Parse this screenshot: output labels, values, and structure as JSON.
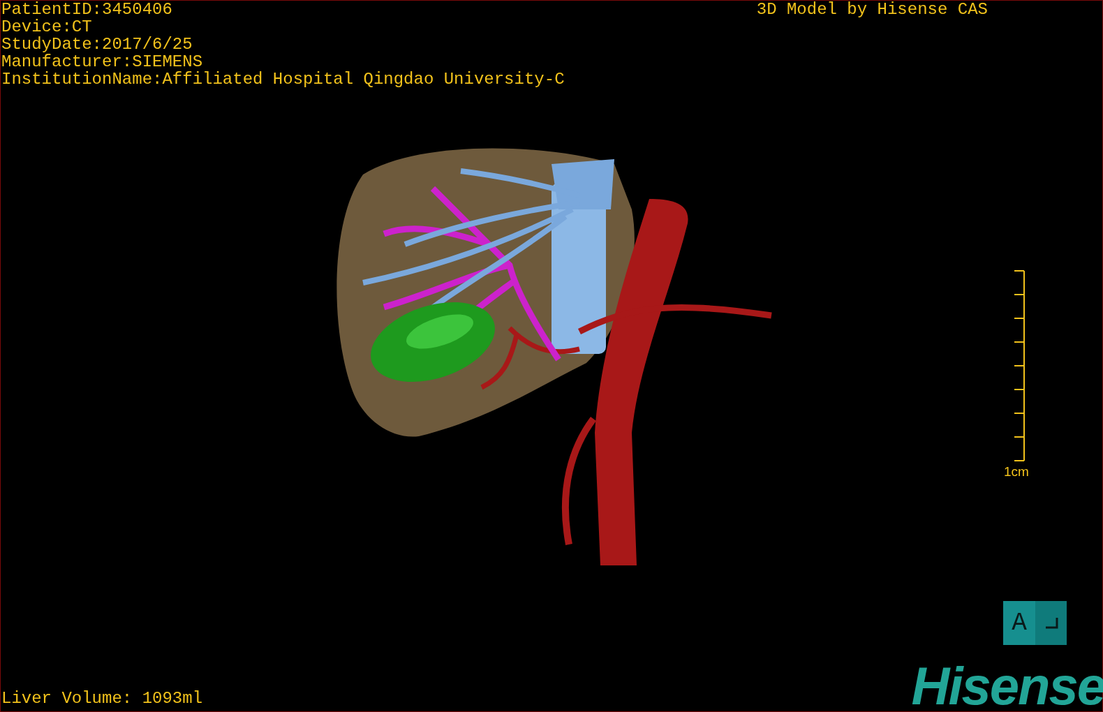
{
  "patient_info": [
    "PatientID:3450406",
    "Device:CT",
    "StudyDate:2017/6/25",
    "Manufacturer:SIEMENS",
    "InstitutionName:Affiliated Hospital Qingdao University-C"
  ],
  "title": "3D Model by Hisense CAS",
  "scale_bar": {
    "label": "1cm"
  },
  "orientation_cube": {
    "label": "A"
  },
  "liver_volume": "Liver Volume: 1093ml",
  "logo": "Hisense"
}
